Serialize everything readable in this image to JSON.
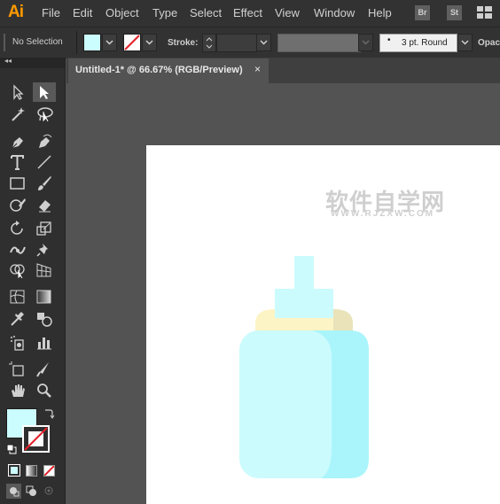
{
  "app": {
    "logo": "Ai"
  },
  "menu": [
    "File",
    "Edit",
    "Object",
    "Type",
    "Select",
    "Effect",
    "View",
    "Window",
    "Help"
  ],
  "bridge_btn": "Br",
  "stock_btn": "St",
  "control_bar": {
    "selection_label": "No Selection",
    "stroke_label": "Stroke:",
    "brush_label": "3 pt. Round",
    "opacity_label": "Opaci"
  },
  "toolbox": {
    "collapse_glyph": "◂◂"
  },
  "document": {
    "tab_title": "Untitled-1* @ 66.67% (RGB/Preview)",
    "close_glyph": "×"
  },
  "watermark": {
    "text": "软件自学网",
    "url": "WWW.RJZXW.COM"
  },
  "colors": {
    "fill": "#ccfdfe",
    "bottle_light": "#ccfbfd",
    "bottle_dark": "#aaf5fb",
    "ring": "#fdf4c5",
    "ring_shade": "#eae3b9",
    "accent_logo": "#ff9a00"
  }
}
